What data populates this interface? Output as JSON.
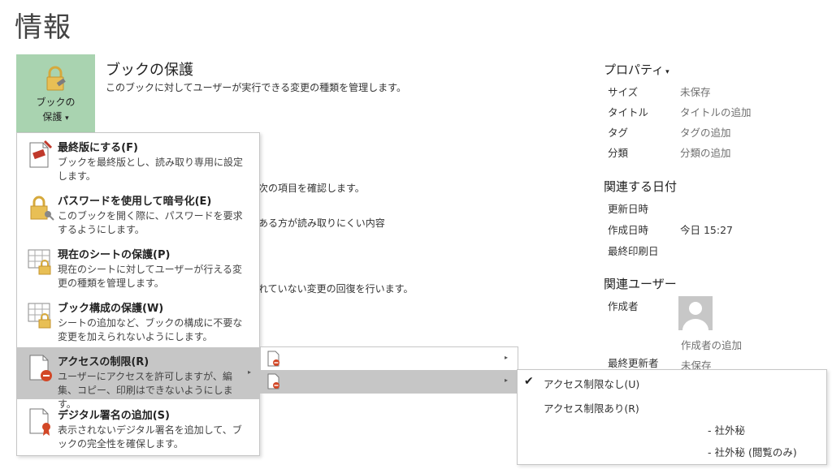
{
  "page": {
    "title": "情報"
  },
  "protect": {
    "tile_line1": "ブックの",
    "tile_line2": "保護",
    "tile_arrow": "▾",
    "heading": "ブックの保護",
    "description": "このブックに対してユーザーが実行できる変更の種類を管理します。"
  },
  "background_fragments": [
    "次の項目を確認します。",
    "ある方が読み取りにくい内容",
    "れていない変更の回復を行います。"
  ],
  "properties": {
    "heading": "プロパティ",
    "heading_arrow": "▾",
    "rows": [
      {
        "label": "サイズ",
        "value": "未保存"
      },
      {
        "label": "タイトル",
        "value": "タイトルの追加"
      },
      {
        "label": "タグ",
        "value": "タグの追加"
      },
      {
        "label": "分類",
        "value": "分類の追加"
      }
    ]
  },
  "related_dates": {
    "heading": "関連する日付",
    "rows": [
      {
        "label": "更新日時",
        "value": ""
      },
      {
        "label": "作成日時",
        "value": "今日 15:27"
      },
      {
        "label": "最終印刷日",
        "value": ""
      }
    ]
  },
  "related_users": {
    "heading": "関連ユーザー",
    "author_label": "作成者",
    "add_author": "作成者の追加",
    "last_modified_label": "最終更新者",
    "last_modified_value": "未保存"
  },
  "menu": {
    "items": [
      {
        "title": "最終版にする(F)",
        "desc": "ブックを最終版とし、読み取り専用に設定します。",
        "icon": "final-document-icon"
      },
      {
        "title": "パスワードを使用して暗号化(E)",
        "desc": "このブックを開く際に、パスワードを要求するようにします。",
        "icon": "lock-key-icon"
      },
      {
        "title": "現在のシートの保護(P)",
        "desc": "現在のシートに対してユーザーが行える変更の種類を管理します。",
        "icon": "sheet-lock-icon"
      },
      {
        "title": "ブック構成の保護(W)",
        "desc": "シートの追加など、ブックの構成に不要な変更を加えられないようにします。",
        "icon": "workbook-structure-lock-icon"
      },
      {
        "title": "アクセスの制限(R)",
        "desc": "ユーザーにアクセスを許可しますが、編集、コピー、印刷はできないようにします。",
        "icon": "restrict-access-icon",
        "has_submenu": true,
        "arrow": "▸"
      },
      {
        "title": "デジタル署名の追加(S)",
        "desc": "表示されないデジタル署名を追加して、ブックの完全性を確保します。",
        "icon": "digital-signature-icon"
      }
    ]
  },
  "submenu_access": {
    "arrow": "▸",
    "items": [
      {
        "icon": "restrict-document-icon"
      },
      {
        "icon": "restrict-document-icon"
      }
    ]
  },
  "submenu_permissions": {
    "check_mark": "✔",
    "items": [
      {
        "label": "アクセス制限なし(U)",
        "checked": true
      },
      {
        "label": "アクセス制限あり(R)",
        "checked": false
      },
      {
        "label": "- 社外秘",
        "checked": false
      },
      {
        "label": "- 社外秘 (閲覧のみ)",
        "checked": false
      }
    ]
  },
  "colors": {
    "protect_tile": "#a9d3b0",
    "menu_highlight": "#c6c6c6",
    "restrict_red": "#d24726",
    "lock_gold": "#e0b84a"
  }
}
